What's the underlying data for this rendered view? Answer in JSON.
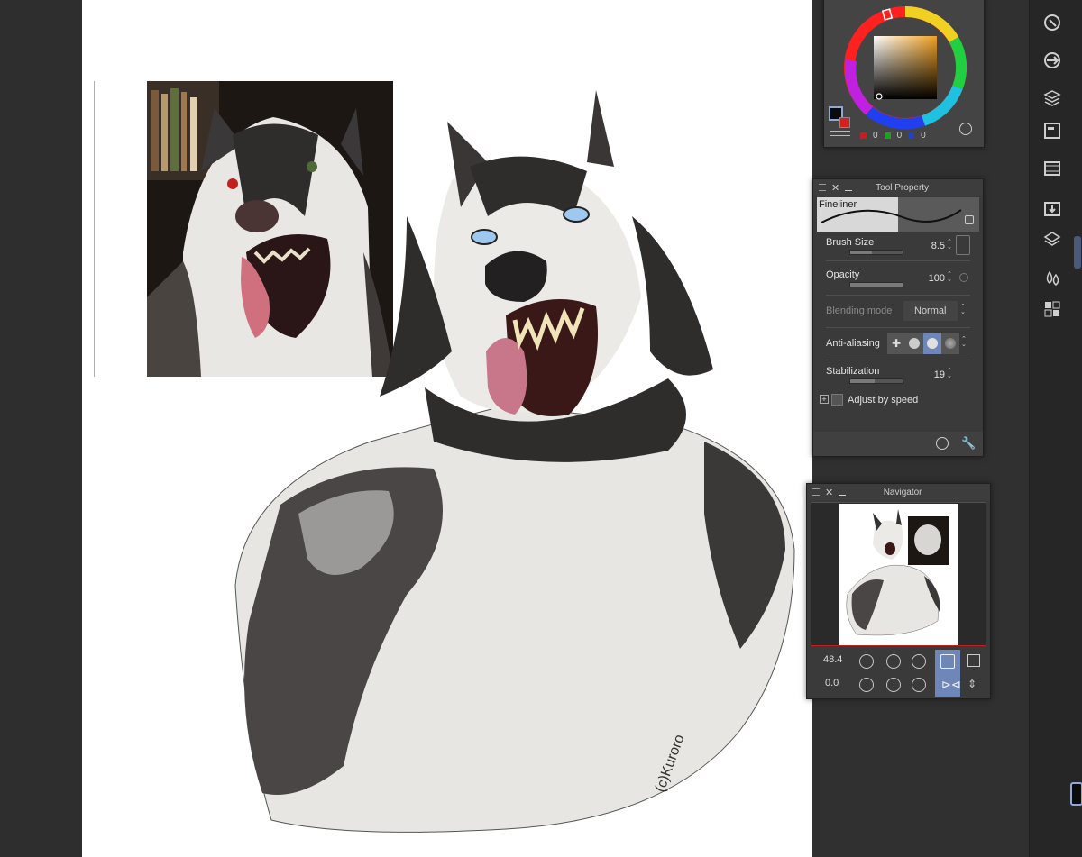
{
  "color_panel": {
    "rgb": {
      "r": "0",
      "g": "0",
      "b": "0"
    },
    "main_color": "#0b0b0b",
    "sub_color": "#d62020",
    "picker_hue_color": "#f0a020"
  },
  "tool_property": {
    "title": "Tool Property",
    "brush_name": "Fineliner",
    "brush_size": {
      "label": "Brush Size",
      "value": "8.5"
    },
    "opacity": {
      "label": "Opacity",
      "value": "100"
    },
    "blending_mode": {
      "label": "Blending mode",
      "value": "Normal"
    },
    "anti_aliasing": {
      "label": "Anti-aliasing"
    },
    "stabilization": {
      "label": "Stabilization",
      "value": "19"
    },
    "adjust_by_speed": {
      "label": "Adjust by speed"
    },
    "slider_levels": {
      "brush_size": 0.42,
      "opacity": 1.0,
      "stabilization": 0.47
    }
  },
  "navigator": {
    "title": "Navigator",
    "zoom": "48.4",
    "rotation": "0.0"
  },
  "canvas": {
    "signature": "(c)Kuroro"
  },
  "right_toolbar": {
    "icons": [
      "navigation-icon",
      "transfer-icon",
      "material-icon",
      "sub-view-icon",
      "timeline-icon",
      "import-icon",
      "layer-icon",
      "ink-icon",
      "tile-icon"
    ]
  }
}
